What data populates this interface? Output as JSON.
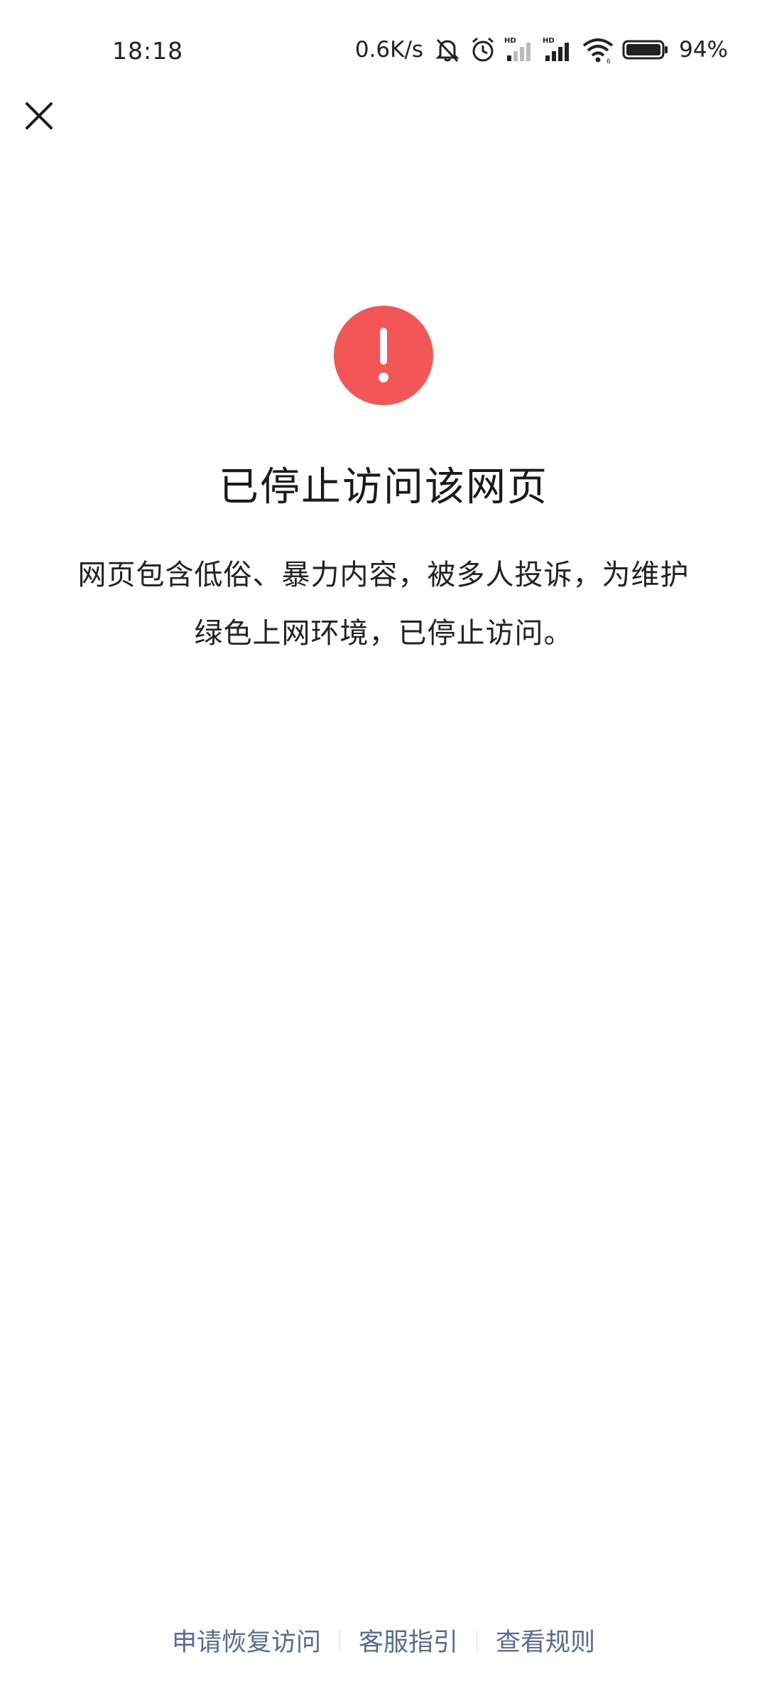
{
  "status_bar": {
    "time": "18:18",
    "net_speed": "0.6K/s",
    "battery_percent": "94%",
    "icons": [
      "mute-icon",
      "alarm-icon",
      "hd-signal-icon",
      "hd-signal-icon",
      "wifi-icon",
      "battery-icon"
    ]
  },
  "nav": {
    "close_icon": "close-icon"
  },
  "main": {
    "alert_icon": "exclamation-icon",
    "alert_color": "#f25656",
    "title": "已停止访问该网页",
    "description": "网页包含低俗、暴力内容，被多人投诉，为维护绿色上网环境，已停止访问。"
  },
  "footer": {
    "links": [
      "申请恢复访问",
      "客服指引",
      "查看规则"
    ],
    "link_color": "#576b95"
  }
}
